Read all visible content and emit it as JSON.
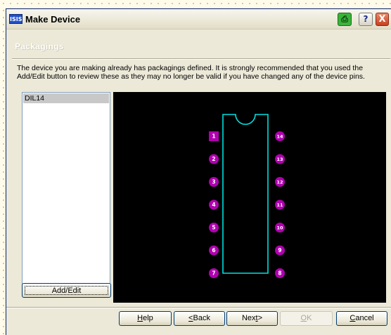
{
  "window": {
    "title": "Make Device",
    "app_icon_text": "ISIS",
    "help_label": "?",
    "close_label": "X"
  },
  "section": {
    "title": "Packagings"
  },
  "description": "The device you are making already has packagings defined. It is strongly recommended that you used the Add/Edit button to review these as they may no longer be valid if you have changed any of the device pins.",
  "packagings": {
    "items": [
      "DIL14"
    ],
    "selected": "DIL14",
    "add_edit_label": "Add/Edit"
  },
  "preview": {
    "package": "DIL14",
    "left_pins": [
      "1",
      "2",
      "3",
      "4",
      "5",
      "6",
      "7"
    ],
    "right_pins": [
      "14",
      "13",
      "12",
      "11",
      "10",
      "9",
      "8"
    ],
    "colors": {
      "background": "#000000",
      "body_outline": "#00e0e0",
      "pad": "#b000b0",
      "pad_label": "#ffffff"
    }
  },
  "footer": {
    "help": {
      "pre": "",
      "accel": "H",
      "post": "elp"
    },
    "back": {
      "pre": "",
      "accel": "<",
      "post": "Back"
    },
    "next": {
      "pre": "Nex",
      "accel": "t",
      "post": ">"
    },
    "ok": {
      "pre": "",
      "accel": "O",
      "post": "K"
    },
    "cancel": {
      "pre": "",
      "accel": "C",
      "post": "ancel"
    }
  }
}
